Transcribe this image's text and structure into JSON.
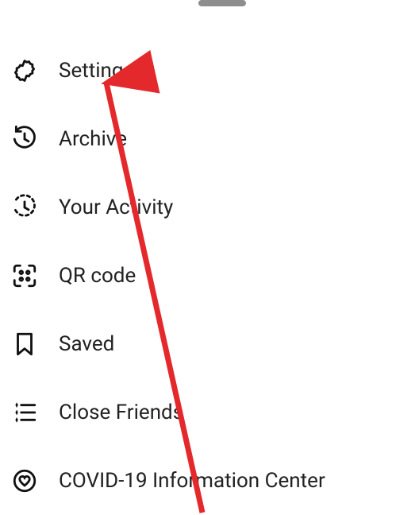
{
  "menu": {
    "items": [
      {
        "label": "Settings"
      },
      {
        "label": "Archive"
      },
      {
        "label": "Your Activity"
      },
      {
        "label": "QR code"
      },
      {
        "label": "Saved"
      },
      {
        "label": "Close Friends"
      },
      {
        "label": "COVID-19 Information Center"
      }
    ]
  },
  "annotation": {
    "arrow_color": "#e3292b"
  }
}
